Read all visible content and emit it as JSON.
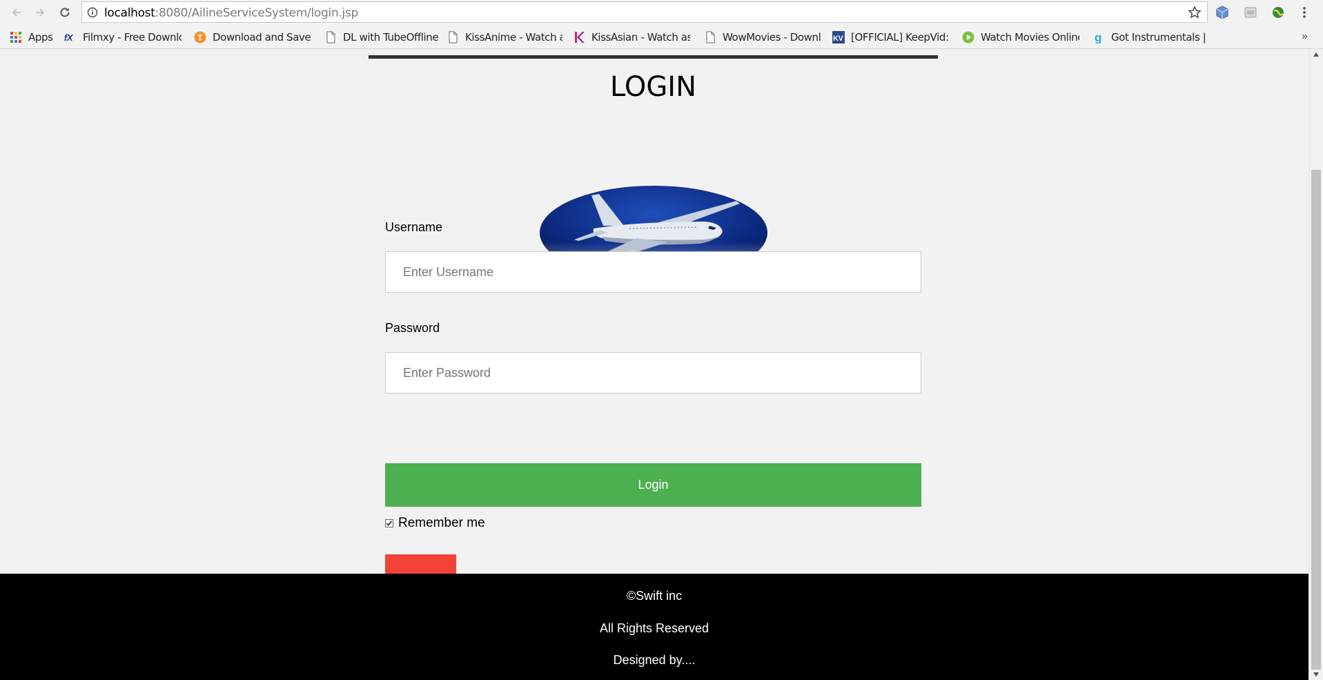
{
  "browser": {
    "url_host": "localhost",
    "url_path": ":8080/AilineServiceSystem/login.jsp",
    "bookmarks": [
      {
        "label": "Apps",
        "icon": "apps-grid-icon"
      },
      {
        "label": "Filmxy - Free Downlo",
        "icon": "filmxy-icon"
      },
      {
        "label": "Download and Save v",
        "icon": "t-orange-icon"
      },
      {
        "label": "DL with TubeOffline",
        "icon": "page-icon"
      },
      {
        "label": "KissAnime - Watch ar",
        "icon": "page-icon"
      },
      {
        "label": "KissAsian - Watch asi",
        "icon": "kissasian-icon"
      },
      {
        "label": "WowMovies - Downlo",
        "icon": "page-icon"
      },
      {
        "label": "[OFFICIAL] KeepVid: D",
        "icon": "keepvid-icon"
      },
      {
        "label": "Watch Movies Online",
        "icon": "play-green-icon"
      },
      {
        "label": "Got Instrumentals | #",
        "icon": "g-blue-icon"
      }
    ],
    "bookmarks_overflow": "»"
  },
  "page": {
    "title": "LOGIN",
    "username_label": "Username",
    "username_placeholder": "Enter Username",
    "password_label": "Password",
    "password_placeholder": "Enter Password",
    "login_button": "Login",
    "remember_label": "Remember me",
    "remember_checked": true
  },
  "footer": {
    "copyright": "©Swift inc",
    "rights": "All Rights Reserved",
    "designed": "Designed by...."
  },
  "colors": {
    "login_button": "#4caf50",
    "cancel_button": "#f44336",
    "footer_bg": "#000000",
    "page_bg": "#f1f1f1"
  }
}
